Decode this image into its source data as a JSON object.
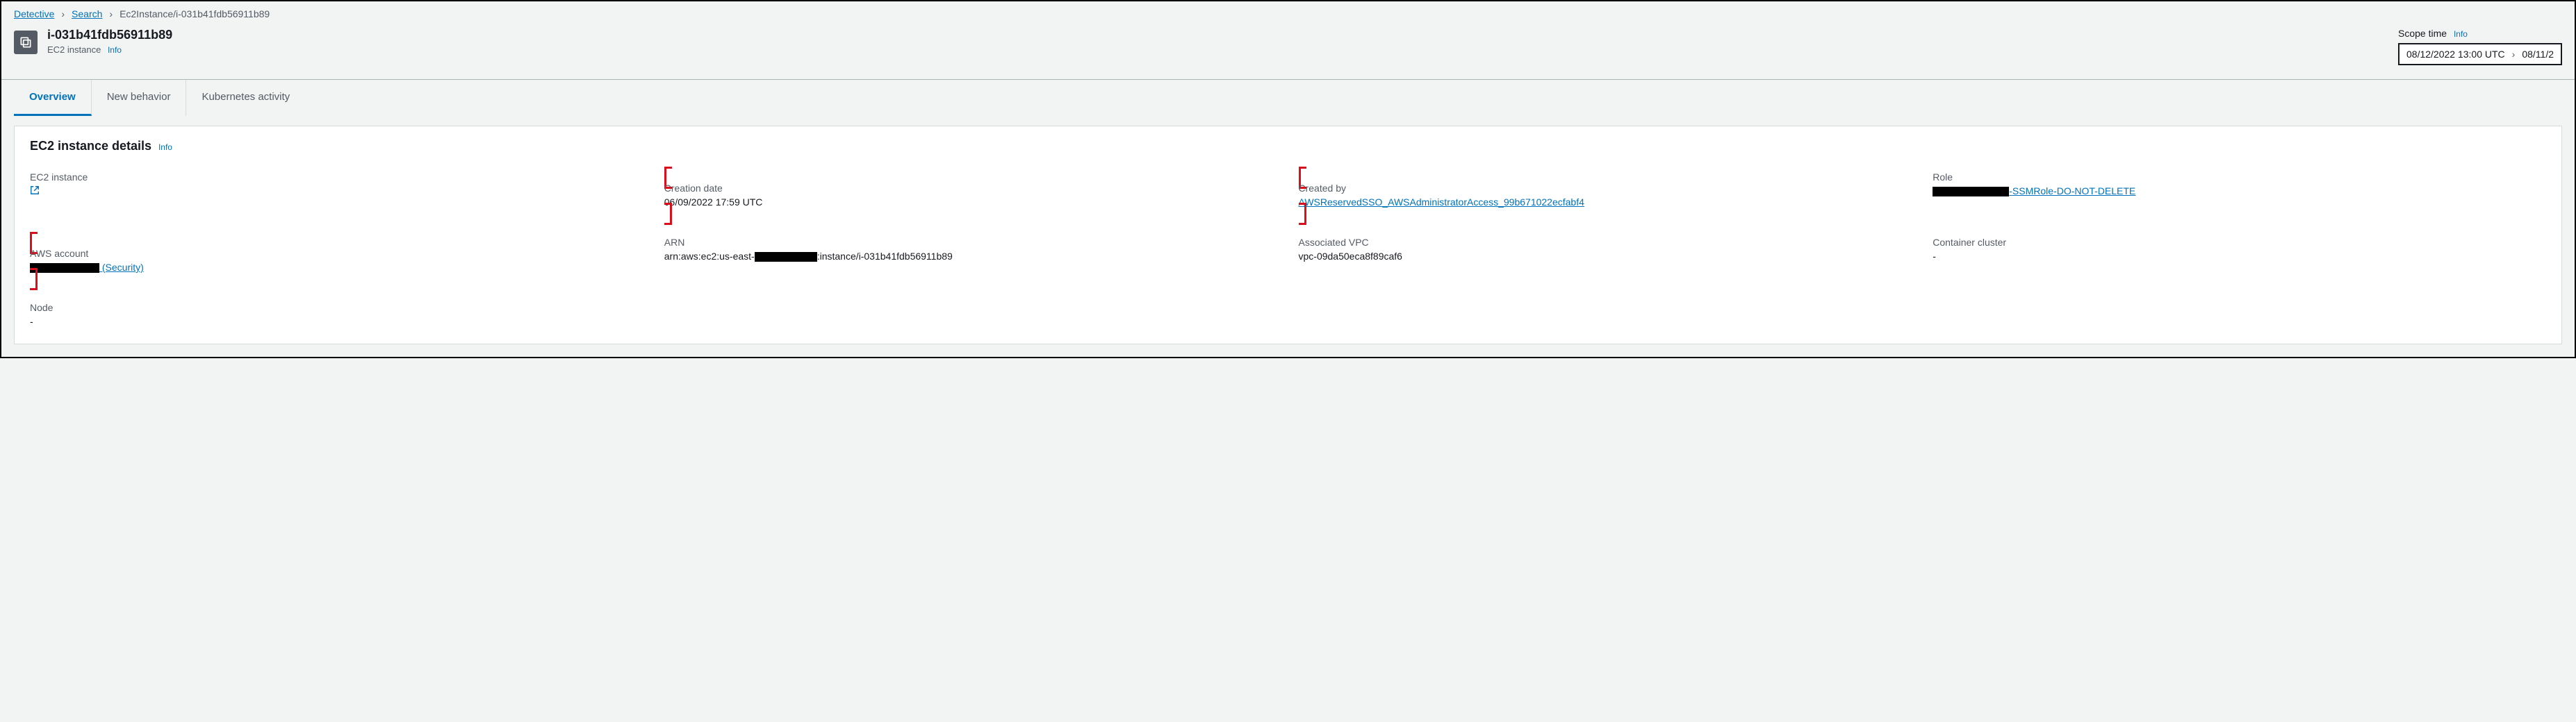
{
  "breadcrumbs": {
    "root": "Detective",
    "search": "Search",
    "current": "Ec2Instance/i-031b41fdb56911b89"
  },
  "header": {
    "title": "i-031b41fdb56911b89",
    "subtitle": "EC2 instance",
    "info": "Info"
  },
  "scope": {
    "label": "Scope time",
    "info": "Info",
    "from": "08/12/2022 13:00 UTC",
    "to": "08/11/2"
  },
  "tabs": {
    "overview": "Overview",
    "new_behavior": "New behavior",
    "k8s": "Kubernetes activity"
  },
  "panel": {
    "title": "EC2 instance details",
    "info": "Info"
  },
  "details": {
    "ec2_instance_label": "EC2 instance",
    "creation_date_label": "Creation date",
    "creation_date_value": "06/09/2022 17:59 UTC",
    "created_by_label": "Created by",
    "created_by_value": "AWSReservedSSO_AWSAdministratorAccess_99b671022ecfabf4",
    "role_label": "Role",
    "role_suffix": "-SSMRole-DO-NOT-DELETE",
    "aws_account_label": "AWS account",
    "aws_account_suffix": "(Security)",
    "arn_label": "ARN",
    "arn_prefix": "arn:aws:ec2:us-east-",
    "arn_suffix": ":instance/i-031b41fdb56911b89",
    "vpc_label": "Associated VPC",
    "vpc_value": "vpc-09da50eca8f89caf6",
    "cluster_label": "Container cluster",
    "cluster_value": "-",
    "node_label": "Node",
    "node_value": "-"
  }
}
